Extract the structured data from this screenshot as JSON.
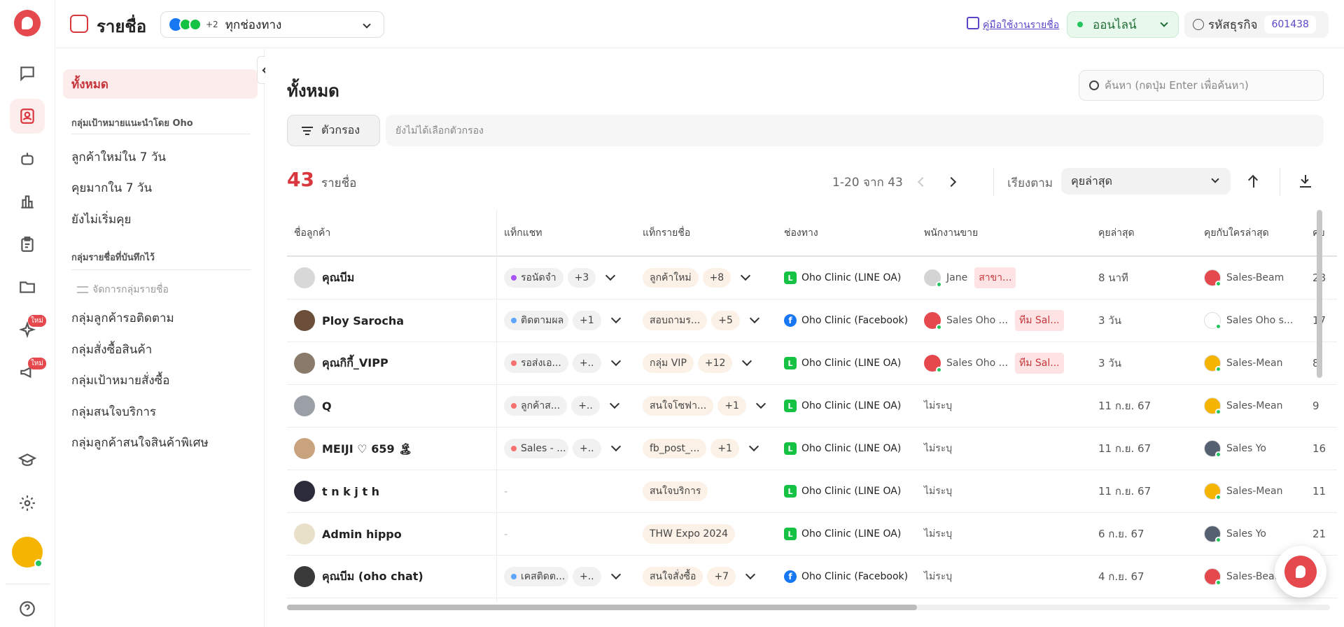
{
  "topbar": {
    "title": "รายชื่อ",
    "channel_extra": "+2",
    "channel_select": "ทุกช่องทาง",
    "guide_link": "คู่มือใช้งานรายชื่อ",
    "status": "ออนไลน์",
    "business_code_label": "รหัสธุรกิจ",
    "business_code": "601438"
  },
  "rail": {
    "new_badge": "ใหม่",
    "items": [
      "chat-icon",
      "contacts-icon",
      "bot-icon",
      "chart-icon",
      "clipboard-icon",
      "folder-icon",
      "sparkle-icon",
      "megaphone-icon",
      "school-icon",
      "settings-icon",
      "help-icon"
    ]
  },
  "sidebar": {
    "all": "ทั้งหมด",
    "recommended_header": "กลุ่มเป้าหมายแนะนำโดย Oho",
    "recommended": [
      "ลูกค้าใหม่ใน 7 วัน",
      "คุยมากใน 7 วัน",
      "ยังไม่เริ่มคุย"
    ],
    "saved_header": "กลุ่มรายชื่อที่บันทึกไว้",
    "manage": "จัดการกลุ่มรายชื่อ",
    "saved": [
      "กลุ่มลูกค้ารอติดตาม",
      "กลุ่มสั่งซื้อสินค้า",
      "กลุ่มเป้าหมายสั่งซื้อ",
      "กลุ่มสนใจบริการ",
      "กลุ่มลูกค้าสนใจสินค้าพิเศษ"
    ]
  },
  "main": {
    "heading": "ทั้งหมด",
    "search_placeholder": "ค้นหา (กดปุ่ม Enter เพื่อค้นหา)",
    "filter_button": "ตัวกรอง",
    "filter_placeholder": "ยังไม่ได้เลือกตัวกรอง",
    "count": "43",
    "count_label": "รายชื่อ",
    "pagination": "1-20 จาก 43",
    "sort_label": "เรียงตาม",
    "sort_value": "คุยล่าสุด"
  },
  "columns": [
    "ชื่อลูกค้า",
    "แท็กแชท",
    "แท็กรายชื่อ",
    "ช่องทาง",
    "พนักงานขาย",
    "คุยล่าสุด",
    "คุยกับใครล่าสุด",
    "คุย"
  ],
  "rows": [
    {
      "name": "คุณบีม",
      "chat_tag": "รอนัดจำ",
      "chat_tag_color": "#a855f7",
      "chat_more": "+3",
      "list_tag": "ลูกค้าใหม่",
      "list_more": "+8",
      "channel": "Oho Clinic (LINE OA)",
      "channel_type": "line",
      "sales": "Jane",
      "sales2": "สาขา...",
      "last": "8 นาที",
      "last_with": "Sales-Beam",
      "extra": "28"
    },
    {
      "name": "Ploy Sarocha",
      "chat_tag": "ติดตามผล",
      "chat_tag_color": "#60a5fa",
      "chat_more": "+1",
      "list_tag": "สอบถามร...",
      "list_more": "+5",
      "channel": "Oho Clinic (Facebook)",
      "channel_type": "fb",
      "sales": "Sales Oho ...",
      "sales2": "ทีม Sal...",
      "last": "3 วัน",
      "last_with": "Sales Oho s...",
      "extra": "17"
    },
    {
      "name": "คุณกิกี้_VIPP",
      "chat_tag": "รอส่งเอ...",
      "chat_tag_color": "#f87171",
      "chat_more": "+..",
      "list_tag": "กลุ่ม VIP",
      "list_more": "+12",
      "channel": "Oho Clinic (LINE OA)",
      "channel_type": "line",
      "sales": "Sales Oho ...",
      "sales2": "ทีม Sal...",
      "last": "3 วัน",
      "last_with": "Sales-Mean",
      "extra": "8"
    },
    {
      "name": "Q",
      "chat_tag": "ลูกค้าส...",
      "chat_tag_color": "#f87171",
      "chat_more": "+..",
      "list_tag": "สนใจโซฟา...",
      "list_more": "+1",
      "channel": "Oho Clinic (LINE OA)",
      "channel_type": "line",
      "sales": "ไม่ระบุ",
      "sales2": "",
      "last": "11 ก.ย. 67",
      "last_with": "Sales-Mean",
      "extra": "9"
    },
    {
      "name": "MEIJI ♡ 659 🏝",
      "chat_tag": "Sales - ...",
      "chat_tag_color": "#f87171",
      "chat_more": "+..",
      "list_tag": "fb_post_...",
      "list_more": "+1",
      "channel": "Oho Clinic (LINE OA)",
      "channel_type": "line",
      "sales": "ไม่ระบุ",
      "sales2": "",
      "last": "11 ก.ย. 67",
      "last_with": "Sales Yo",
      "extra": "16"
    },
    {
      "name": "t n k j t h",
      "chat_tag": "",
      "chat_tag_color": "",
      "chat_more": "",
      "list_tag": "สนใจบริการ",
      "list_more": "",
      "channel": "Oho Clinic (LINE OA)",
      "channel_type": "line",
      "sales": "ไม่ระบุ",
      "sales2": "",
      "last": "11 ก.ย. 67",
      "last_with": "Sales-Mean",
      "extra": "11"
    },
    {
      "name": "Admin hippo",
      "chat_tag": "",
      "chat_tag_color": "",
      "chat_more": "",
      "list_tag": "THW Expo 2024",
      "list_more": "",
      "channel": "Oho Clinic (LINE OA)",
      "channel_type": "line",
      "sales": "ไม่ระบุ",
      "sales2": "",
      "last": "6 ก.ย. 67",
      "last_with": "Sales Yo",
      "extra": "21"
    },
    {
      "name": "คุณบีม (oho chat)",
      "chat_tag": "เคสติดต...",
      "chat_tag_color": "#60a5fa",
      "chat_more": "+..",
      "list_tag": "สนใจสั่งซื้อ",
      "list_more": "+7",
      "channel": "Oho Clinic (Facebook)",
      "channel_type": "fb",
      "sales": "ไม่ระบุ",
      "sales2": "",
      "last": "4 ก.ย. 67",
      "last_with": "Sales-Beam",
      "extra": ""
    }
  ]
}
